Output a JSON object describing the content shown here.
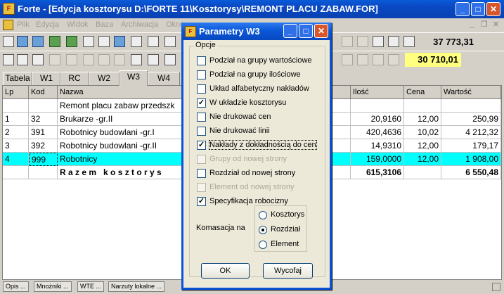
{
  "window": {
    "title": "Forte - [Edycja kosztorysu D:\\FORTE 11\\Kosztorysy\\REMONT PLACU ZABAW.FOR]",
    "icon_text": "F"
  },
  "menu": [
    "Plik",
    "Edycja",
    "Widok",
    "Baza",
    "Archiwacja",
    "Okno"
  ],
  "toolbar": {
    "sum_top": "37 773,31",
    "sum_bottom": "30 710,01",
    "sum_top_color": "#d4d0c8",
    "sum_bottom_color": "#ffff80"
  },
  "tabs": [
    "Tabela",
    "W1",
    "RC",
    "W2",
    "W3",
    "W4"
  ],
  "active_tab": "W3",
  "table": {
    "headers": [
      "Lp",
      "Kod",
      "Nazwa",
      "Ilość",
      "Cena",
      "Wartość"
    ],
    "title_row": "Remont placu zabaw przedszk",
    "rows": [
      {
        "lp": "1",
        "kod": "32",
        "nazwa": "Brukarze -gr.II",
        "ilosc": "20,9160",
        "cena": "12,00",
        "wartosc": "250,99"
      },
      {
        "lp": "2",
        "kod": "391",
        "nazwa": "Robotnicy budowlani -gr.I",
        "ilosc": "420,4636",
        "cena": "10,02",
        "wartosc": "4 212,32"
      },
      {
        "lp": "3",
        "kod": "392",
        "nazwa": "Robotnicy budowlani -gr.II",
        "ilosc": "14,9310",
        "cena": "12,00",
        "wartosc": "179,17"
      },
      {
        "lp": "4",
        "kod": "999",
        "nazwa": "Robotnicy",
        "ilosc": "159,0000",
        "cena": "12,00",
        "wartosc": "1 908,00"
      }
    ],
    "total": {
      "label": "R a z e m   k o s z t o r y s",
      "ilosc": "615,3106",
      "wartosc": "6 550,48"
    },
    "selected_color": "#00ffff"
  },
  "statusbar": [
    "Opis ...",
    "Mnożniki ...",
    "WTE ...",
    "Narzuty lokalne ..."
  ],
  "dialog": {
    "title": "Parametry W3",
    "group_label": "Opcje",
    "options": [
      {
        "label": "Podział na grupy wartościowe",
        "checked": false,
        "enabled": true
      },
      {
        "label": "Podział na grupy ilościowe",
        "checked": false,
        "enabled": true
      },
      {
        "label": "Układ alfabetyczny nakładów",
        "checked": false,
        "enabled": true
      },
      {
        "label": "W układzie kosztorysu",
        "checked": true,
        "enabled": true
      },
      {
        "label": "Nie drukować cen",
        "checked": false,
        "enabled": true
      },
      {
        "label": "Nie drukować linii",
        "checked": false,
        "enabled": true
      },
      {
        "label": "Nakłady z dokładnością do cen",
        "checked": true,
        "enabled": true
      },
      {
        "label": "Grupy od nowej strony",
        "checked": false,
        "enabled": false
      },
      {
        "label": "Rozdział od nowej strony",
        "checked": false,
        "enabled": true
      },
      {
        "label": "Element od nowej strony",
        "checked": false,
        "enabled": false
      },
      {
        "label": "Specyfikacja robocizny",
        "checked": true,
        "enabled": true
      }
    ],
    "komasacja_label": "Komasacja na",
    "radio": [
      {
        "label": "Kosztorys",
        "selected": false
      },
      {
        "label": "Rozdział",
        "selected": true
      },
      {
        "label": "Element",
        "selected": false
      }
    ],
    "ok_label": "OK",
    "cancel_label": "Wycofaj"
  }
}
